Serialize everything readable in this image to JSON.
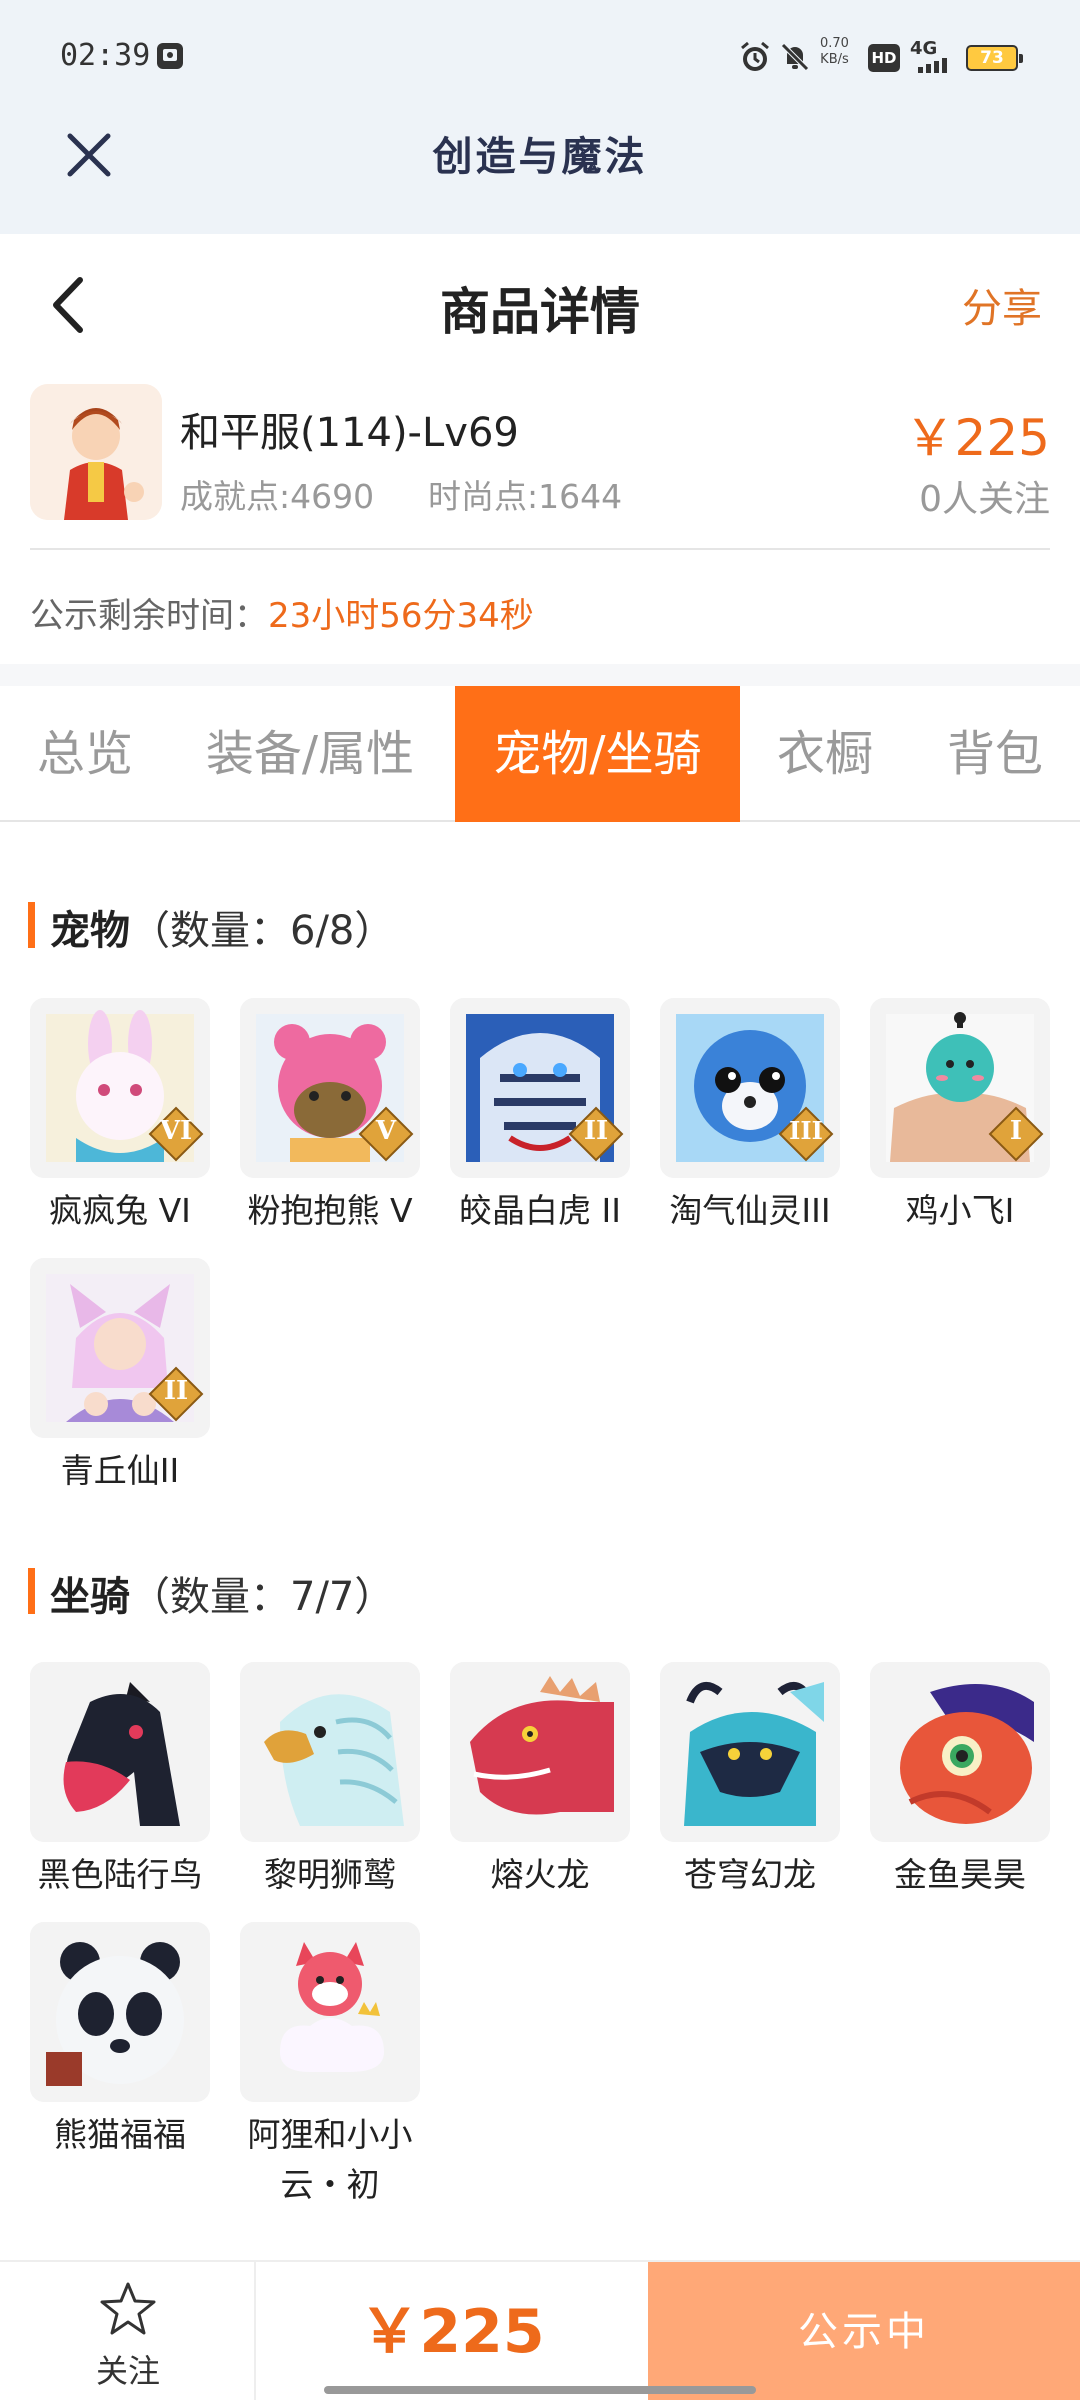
{
  "status_bar": {
    "time": "02:39",
    "net_speed_value": "0.70",
    "net_speed_unit": "KB/s",
    "hd": "HD",
    "network": "4G",
    "battery": "73",
    "icons": [
      "screenshot-icon",
      "alarm-icon",
      "mute-icon",
      "signal-icon",
      "battery-icon"
    ]
  },
  "app_bar": {
    "title": "创造与魔法"
  },
  "header": {
    "title": "商品详情",
    "share": "分享"
  },
  "product": {
    "name": "和平服(114)-Lv69",
    "achievement": "成就点:4690",
    "fashion": "时尚点:1644",
    "price": "￥225",
    "followers": "0人关注"
  },
  "timer": {
    "label": "公示剩余时间：",
    "value": "23小时56分34秒"
  },
  "tabs": [
    {
      "label": "总览",
      "active": false
    },
    {
      "label": "装备/属性",
      "active": false
    },
    {
      "label": "宠物/坐骑",
      "active": true
    },
    {
      "label": "衣橱",
      "active": false
    },
    {
      "label": "背包",
      "active": false
    }
  ],
  "pets": {
    "title": "宠物",
    "count": "（数量：6/8）",
    "items": [
      {
        "name": "疯疯兔 VI",
        "badge": "VI"
      },
      {
        "name": "粉抱抱熊 V",
        "badge": "V"
      },
      {
        "name": "皎晶白虎 II",
        "badge": "II"
      },
      {
        "name": "淘气仙灵III",
        "badge": "III"
      },
      {
        "name": "鸡小飞I",
        "badge": "I"
      },
      {
        "name": "青丘仙II",
        "badge": "II"
      }
    ]
  },
  "mounts": {
    "title": "坐骑",
    "count": "（数量：7/7）",
    "items": [
      {
        "name": "黑色陆行鸟"
      },
      {
        "name": "黎明狮鹫"
      },
      {
        "name": "熔火龙"
      },
      {
        "name": "苍穹幻龙"
      },
      {
        "name": "金鱼昊昊"
      },
      {
        "name": "熊猫福福"
      },
      {
        "name": "阿狸和小小云・初"
      }
    ]
  },
  "bottom_bar": {
    "follow": "关注",
    "price": "￥225",
    "status": "公示中"
  },
  "colors": {
    "accent": "#ff6f17",
    "price": "#ee6a1b",
    "buy_button": "#ffa877",
    "app_bar_bg": "#eef3f8"
  }
}
